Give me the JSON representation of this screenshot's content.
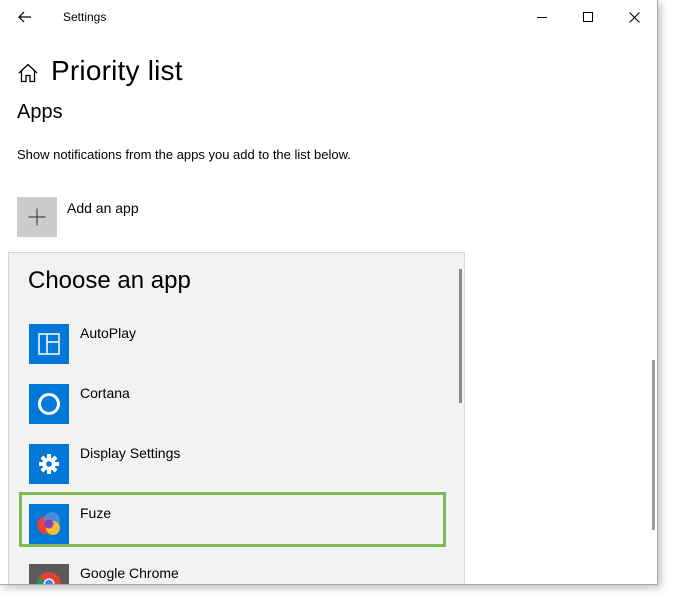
{
  "window": {
    "title": "Settings"
  },
  "page": {
    "title": "Priority list",
    "section_title": "Apps",
    "description": "Show notifications from the apps you add to the list below.",
    "add_label": "Add an app"
  },
  "picker": {
    "title": "Choose an app",
    "apps": [
      {
        "label": "AutoPlay",
        "icon": "autoplay-icon",
        "tile_color": "#0078d7"
      },
      {
        "label": "Cortana",
        "icon": "cortana-icon",
        "tile_color": "#0078d7"
      },
      {
        "label": "Display Settings",
        "icon": "gear-icon",
        "tile_color": "#0078d7"
      },
      {
        "label": "Fuze",
        "icon": "fuze-icon",
        "tile_color": "#0078d7",
        "highlighted": true
      },
      {
        "label": "Google Chrome",
        "icon": "chrome-icon",
        "tile_color": "#5a5a5a"
      }
    ]
  },
  "colors": {
    "accent": "#0078d7",
    "highlight": "#7cbb54"
  }
}
